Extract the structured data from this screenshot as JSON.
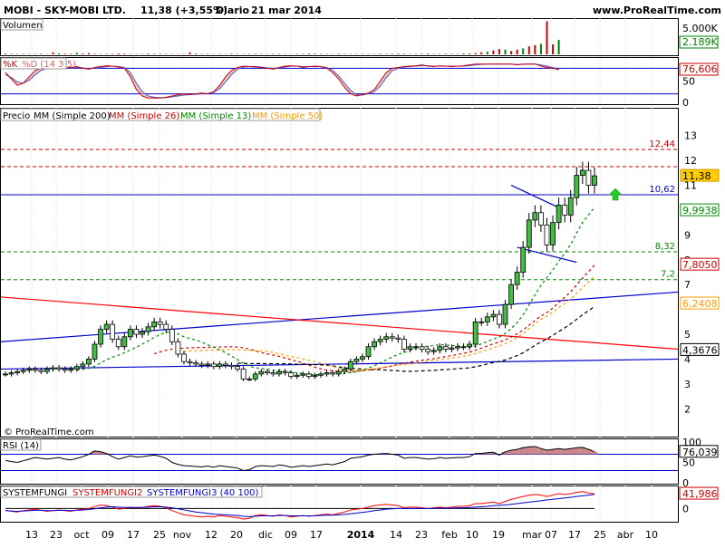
{
  "header": {
    "ticker_info": "MOBI - SKY-MOBI LTD.",
    "price_change": "11,38 (+3,55%)",
    "period": "Diario",
    "date": "21 mar 2014",
    "website": "www.ProRealTime.com"
  },
  "copyright": "© ProRealTime.com",
  "colors": {
    "volume": "#cc0000",
    "volume_up": "#008000",
    "stoch_k": "#cc0000",
    "stoch_d": "#5555cc",
    "price_up": "#44bb44",
    "price_down": "#ffffff",
    "ma200": "#000000",
    "ma26": "#cc0000",
    "ma13": "#008800",
    "ma50": "#ff9900",
    "trend_blue": "#0000cc",
    "trend_red": "#ff0000",
    "rsi": "#000000",
    "sf1": "#000000",
    "sf2": "#ff0000",
    "sf3": "#0000cc",
    "grid": "#dddddd"
  },
  "chart_data": [
    {
      "type": "bar",
      "panel": "volume",
      "legend": "Volumen",
      "y_ticks": [
        "5.000K"
      ],
      "last_value_label": "2.189K",
      "values_k": [
        120,
        80,
        60,
        70,
        50,
        60,
        90,
        40,
        300,
        150,
        100,
        80,
        250,
        120,
        200,
        90,
        60,
        70,
        80,
        150,
        100,
        60,
        50,
        40,
        120,
        80,
        60,
        70,
        50,
        40,
        60,
        300,
        100,
        80,
        60,
        50,
        70,
        40,
        80,
        60,
        50,
        80,
        70,
        60,
        40,
        90,
        60,
        50,
        40,
        60,
        80,
        120,
        100,
        70,
        60,
        50,
        80,
        60,
        40,
        70,
        60,
        50,
        40,
        90,
        60,
        80,
        120,
        70,
        50,
        60,
        80,
        100,
        60,
        60,
        90,
        80,
        60,
        120,
        150,
        200,
        300,
        400,
        600,
        800,
        700,
        500,
        700,
        900,
        1200,
        1400,
        1600,
        5000,
        1500,
        2189
      ]
    },
    {
      "type": "line",
      "panel": "stochastic",
      "legend_k": "%K",
      "legend_d": "%D (14 3 5)",
      "y_ticks": [
        "50",
        "0"
      ],
      "last_value_label": "76,606",
      "series": [
        {
          "name": "%K",
          "values": [
            70,
            55,
            40,
            45,
            60,
            75,
            80,
            85,
            85,
            82,
            80,
            82,
            84,
            80,
            78,
            82,
            84,
            86,
            85,
            83,
            80,
            60,
            30,
            15,
            10,
            10,
            10,
            12,
            15,
            18,
            20,
            18,
            20,
            22,
            20,
            25,
            40,
            60,
            75,
            82,
            85,
            84,
            83,
            82,
            80,
            78,
            82,
            85,
            86,
            85,
            82,
            84,
            85,
            84,
            80,
            70,
            55,
            35,
            20,
            15,
            18,
            22,
            30,
            50,
            70,
            80,
            82,
            84,
            85,
            86,
            88,
            85,
            84,
            86,
            85,
            84,
            85,
            86,
            88,
            90,
            90,
            90,
            90,
            90,
            90,
            90,
            88,
            90,
            90,
            90,
            85,
            82,
            80,
            76.6
          ]
        },
        {
          "name": "%D",
          "values": [
            65,
            58,
            48,
            45,
            52,
            65,
            75,
            80,
            83,
            83,
            81,
            81,
            82,
            81,
            79,
            80,
            82,
            84,
            85,
            84,
            82,
            70,
            45,
            25,
            15,
            12,
            11,
            11,
            13,
            15,
            17,
            18,
            19,
            20,
            21,
            23,
            32,
            48,
            65,
            78,
            83,
            84,
            84,
            83,
            81,
            80,
            81,
            83,
            85,
            85,
            84,
            84,
            84,
            84,
            82,
            75,
            62,
            45,
            28,
            18,
            17,
            20,
            25,
            38,
            58,
            74,
            80,
            83,
            84,
            85,
            86,
            86,
            85,
            85,
            85,
            85,
            85,
            85,
            86,
            88,
            89,
            90,
            90,
            90,
            90,
            90,
            89,
            89,
            90,
            90,
            88,
            85,
            82,
            78
          ]
        }
      ]
    },
    {
      "type": "candlestick",
      "panel": "price",
      "legend": [
        "Precio",
        "MM (Simple 200)",
        "MM (Simple 26)",
        "MM (Simple 13)",
        "MM (Simple 50)"
      ],
      "y_ticks": [
        "13",
        "12",
        "11",
        "9",
        "8",
        "7",
        "5",
        "4",
        "3",
        "2"
      ],
      "ylim": [
        1.5,
        13.5
      ],
      "price_labels": [
        {
          "value": 11.38,
          "label": "11,38"
        },
        {
          "value": 9.9938,
          "label": "9,9938"
        },
        {
          "value": 7.805,
          "label": "7,8050"
        },
        {
          "value": 6.2408,
          "label": "6,2408"
        },
        {
          "value": 4.3676,
          "label": "4,3676"
        }
      ],
      "horizontal_levels": [
        {
          "value": 12.44,
          "label": "12,44",
          "style": "red-dashed"
        },
        {
          "value": 11.75,
          "label": "",
          "style": "red-dashed"
        },
        {
          "value": 10.62,
          "label": "10,62",
          "style": "blue-solid"
        },
        {
          "value": 8.32,
          "label": "8,32",
          "style": "green-dashed"
        },
        {
          "value": 7.2,
          "label": "7,2",
          "style": "green-dashed"
        }
      ],
      "closes": [
        3.4,
        3.45,
        3.5,
        3.55,
        3.6,
        3.55,
        3.5,
        3.6,
        3.65,
        3.6,
        3.55,
        3.6,
        3.7,
        3.8,
        4.0,
        4.6,
        5.2,
        5.4,
        4.8,
        4.5,
        4.9,
        5.2,
        5.0,
        5.1,
        5.3,
        5.5,
        5.4,
        5.2,
        4.7,
        4.2,
        3.9,
        3.85,
        3.8,
        3.75,
        3.8,
        3.7,
        3.8,
        3.75,
        3.7,
        3.6,
        3.2,
        3.2,
        3.4,
        3.5,
        3.45,
        3.4,
        3.5,
        3.45,
        3.3,
        3.35,
        3.4,
        3.3,
        3.35,
        3.4,
        3.45,
        3.4,
        3.5,
        3.6,
        3.9,
        4.0,
        4.1,
        4.5,
        4.7,
        4.8,
        4.9,
        4.85,
        4.8,
        4.4,
        4.5,
        4.5,
        4.4,
        4.3,
        4.35,
        4.5,
        4.4,
        4.45,
        4.5,
        4.5,
        4.6,
        5.5,
        5.5,
        5.7,
        5.8,
        5.4,
        6.2,
        7.0,
        7.5,
        8.5,
        9.6,
        9.9,
        9.4,
        8.6,
        9.5,
        10.2,
        9.8,
        10.5,
        11.4,
        11.6,
        11.0,
        11.38
      ],
      "start_index": 0
    },
    {
      "type": "line",
      "panel": "rsi",
      "legend": "RSI (14)",
      "y_ticks": [
        "100",
        "50",
        "0"
      ],
      "last_value_label": "76,039",
      "series": [
        {
          "name": "RSI (14)",
          "values": [
            55,
            52,
            50,
            54,
            58,
            62,
            60,
            58,
            60,
            62,
            58,
            56,
            60,
            64,
            70,
            78,
            76,
            72,
            64,
            58,
            62,
            66,
            63,
            64,
            66,
            68,
            65,
            60,
            50,
            45,
            42,
            41,
            40,
            39,
            41,
            38,
            42,
            40,
            38,
            36,
            30,
            32,
            40,
            42,
            41,
            40,
            44,
            42,
            38,
            40,
            42,
            40,
            42,
            44,
            46,
            44,
            48,
            52,
            60,
            62,
            64,
            68,
            70,
            71,
            72,
            70,
            68,
            60,
            62,
            62,
            60,
            58,
            59,
            62,
            60,
            61,
            62,
            62,
            64,
            72,
            72,
            74,
            75,
            68,
            76,
            80,
            82,
            86,
            88,
            89,
            84,
            80,
            82,
            84,
            82,
            84,
            86,
            87,
            82,
            76.039
          ]
        }
      ]
    },
    {
      "type": "line",
      "panel": "systemfungi",
      "legend": [
        "SYSTEMFUNGI",
        "SYSTEMFUNGI2",
        "SYSTEMFUNGI3 (40 100)"
      ],
      "y_ticks": [
        "0"
      ],
      "last_value_label": "41,986",
      "series": [
        {
          "name": "SYSTEMFUNGI",
          "values": [
            0,
            0,
            0,
            0,
            0,
            0,
            0,
            0,
            0,
            0,
            0,
            0,
            0,
            0,
            0,
            0,
            0,
            0,
            0,
            0,
            0,
            0,
            0,
            0,
            0,
            0,
            0,
            0,
            0,
            0,
            0,
            0,
            0,
            0,
            0,
            0,
            0,
            0,
            0,
            0,
            0,
            0,
            0,
            0,
            0,
            0,
            0,
            0,
            0,
            0,
            0,
            0,
            0,
            0,
            0,
            0,
            0,
            0,
            0,
            0,
            0,
            0,
            0,
            0,
            0,
            0,
            0,
            0,
            0,
            0,
            0,
            0,
            0,
            0,
            0,
            0,
            0,
            0,
            0,
            0,
            0,
            0,
            0,
            0,
            0,
            0,
            0,
            0,
            0,
            0,
            0,
            0,
            0,
            0,
            0,
            0,
            0,
            0,
            0,
            0
          ]
        },
        {
          "name": "SYSTEMFUNGI2",
          "values": [
            -5,
            -8,
            -10,
            -6,
            -4,
            -2,
            -5,
            -8,
            -6,
            -4,
            -6,
            -8,
            -4,
            -2,
            0,
            5,
            10,
            8,
            4,
            -2,
            0,
            4,
            2,
            3,
            6,
            8,
            6,
            2,
            -6,
            -12,
            -18,
            -20,
            -22,
            -24,
            -22,
            -24,
            -20,
            -22,
            -24,
            -26,
            -30,
            -28,
            -20,
            -18,
            -20,
            -22,
            -18,
            -20,
            -24,
            -22,
            -20,
            -22,
            -20,
            -18,
            -16,
            -18,
            -14,
            -10,
            -4,
            -2,
            0,
            4,
            8,
            10,
            12,
            10,
            8,
            2,
            4,
            4,
            2,
            0,
            2,
            4,
            2,
            4,
            6,
            6,
            8,
            14,
            14,
            16,
            18,
            14,
            20,
            26,
            30,
            34,
            38,
            40,
            38,
            34,
            38,
            42,
            40,
            42,
            46,
            48,
            44,
            41.986
          ]
        },
        {
          "name": "SYSTEMFUNGI3",
          "values": [
            -6,
            -7,
            -8,
            -7,
            -6,
            -5,
            -5,
            -6,
            -6,
            -5,
            -5,
            -6,
            -5,
            -4,
            -3,
            -1,
            2,
            4,
            5,
            4,
            3,
            3,
            3,
            3,
            4,
            5,
            5,
            4,
            2,
            -1,
            -4,
            -7,
            -10,
            -12,
            -14,
            -16,
            -17,
            -18,
            -19,
            -20,
            -22,
            -23,
            -22,
            -21,
            -21,
            -21,
            -20,
            -20,
            -21,
            -21,
            -21,
            -21,
            -21,
            -20,
            -19,
            -19,
            -18,
            -17,
            -15,
            -13,
            -11,
            -9,
            -6,
            -4,
            -2,
            -1,
            0,
            0,
            0,
            0,
            0,
            0,
            0,
            1,
            1,
            1,
            2,
            2,
            3,
            4,
            5,
            6,
            8,
            9,
            10,
            12,
            14,
            16,
            18,
            20,
            22,
            24,
            26,
            28,
            30,
            32,
            34,
            36,
            38,
            40
          ]
        }
      ]
    }
  ],
  "x_axis": {
    "ticks": [
      "13",
      "23",
      "oct",
      "09",
      "17",
      "25",
      "nov",
      "12",
      "20",
      "dic",
      "09",
      "17",
      "2014",
      "14",
      "23",
      "feb",
      "10",
      "19",
      "mar",
      "07",
      "17",
      "25",
      "abr",
      "10"
    ]
  }
}
